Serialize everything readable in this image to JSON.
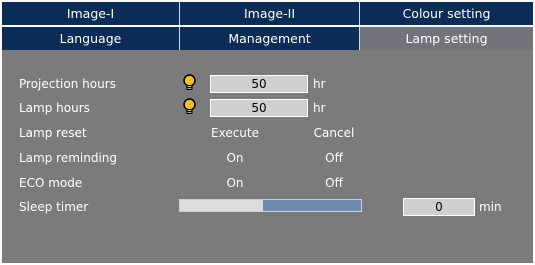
{
  "tabs_row1": [
    {
      "label": "Image-I",
      "active": false
    },
    {
      "label": "Image-II",
      "active": false
    },
    {
      "label": "Colour setting",
      "active": false
    }
  ],
  "tabs_row2": [
    {
      "label": "Language",
      "active": false
    },
    {
      "label": "Management",
      "active": false
    },
    {
      "label": "Lamp setting",
      "active": true
    }
  ],
  "settings": {
    "projection_hours": {
      "label": "Projection hours",
      "value": "50",
      "unit": "hr",
      "icon": "lamp-bulb-icon"
    },
    "lamp_hours": {
      "label": "Lamp hours",
      "value": "50",
      "unit": "hr",
      "icon": "lamp-bulb-icon"
    },
    "lamp_reset": {
      "label": "Lamp reset",
      "option_a": "Execute",
      "option_b": "Cancel"
    },
    "lamp_reminding": {
      "label": "Lamp reminding",
      "option_a": "On",
      "option_b": "Off"
    },
    "eco_mode": {
      "label": "ECO mode",
      "option_a": "On",
      "option_b": "Off"
    },
    "sleep_timer": {
      "label": "Sleep timer",
      "value": "0",
      "unit": "min",
      "slider_fraction": 0.46
    }
  },
  "colors": {
    "tab_dark": "#0a2c57",
    "tab_active": "#73737b",
    "panel": "#7b7b7b",
    "slider_track": "#6f8bb0"
  }
}
